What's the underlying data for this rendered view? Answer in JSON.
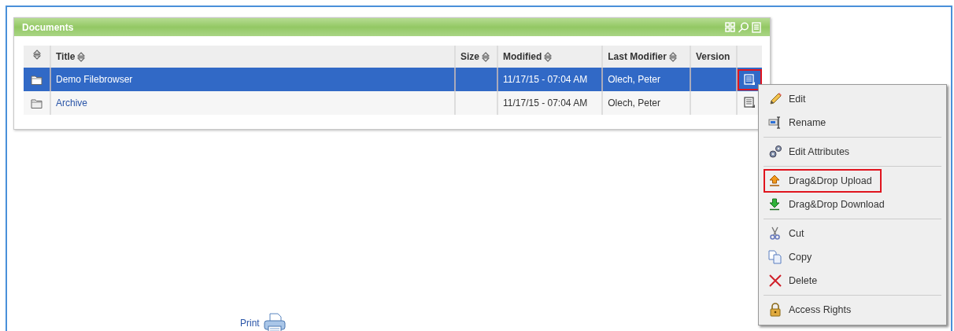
{
  "panel": {
    "title": "Documents"
  },
  "table": {
    "columns": [
      {
        "sortable": true
      },
      {
        "label": "Title",
        "sortable": true
      },
      {
        "label": "Size",
        "sortable": true
      },
      {
        "label": "Modified",
        "sortable": true
      },
      {
        "label": "Last Modifier",
        "sortable": true
      },
      {
        "label": "Version",
        "sortable": false
      },
      {
        "sortable": false
      }
    ],
    "rows": [
      {
        "kind": "folder",
        "title": "Demo Filebrowser",
        "modified": "11/17/15 - 07:04 AM",
        "last_modifier": "Olech, Peter",
        "selected": true,
        "annotated": true
      },
      {
        "kind": "folder",
        "title": "Archive",
        "modified": "11/17/15 - 07:04 AM",
        "last_modifier": "Olech, Peter",
        "selected": false,
        "annotated": false
      }
    ]
  },
  "context_menu": {
    "items": [
      {
        "kind": "item",
        "label": "Edit",
        "annotated": false
      },
      {
        "kind": "item",
        "label": "Rename",
        "annotated": false
      },
      {
        "kind": "separator"
      },
      {
        "kind": "item",
        "label": "Edit Attributes",
        "annotated": false
      },
      {
        "kind": "separator"
      },
      {
        "kind": "item",
        "label": "Drag&Drop Upload",
        "annotated": true
      },
      {
        "kind": "item",
        "label": "Drag&Drop Download",
        "annotated": false
      },
      {
        "kind": "separator"
      },
      {
        "kind": "item",
        "label": "Cut",
        "annotated": false
      },
      {
        "kind": "item",
        "label": "Copy",
        "annotated": false
      },
      {
        "kind": "item",
        "label": "Delete",
        "annotated": false
      },
      {
        "kind": "separator"
      },
      {
        "kind": "item",
        "label": "Access Rights",
        "annotated": false
      }
    ]
  },
  "print": {
    "label": "Print"
  }
}
